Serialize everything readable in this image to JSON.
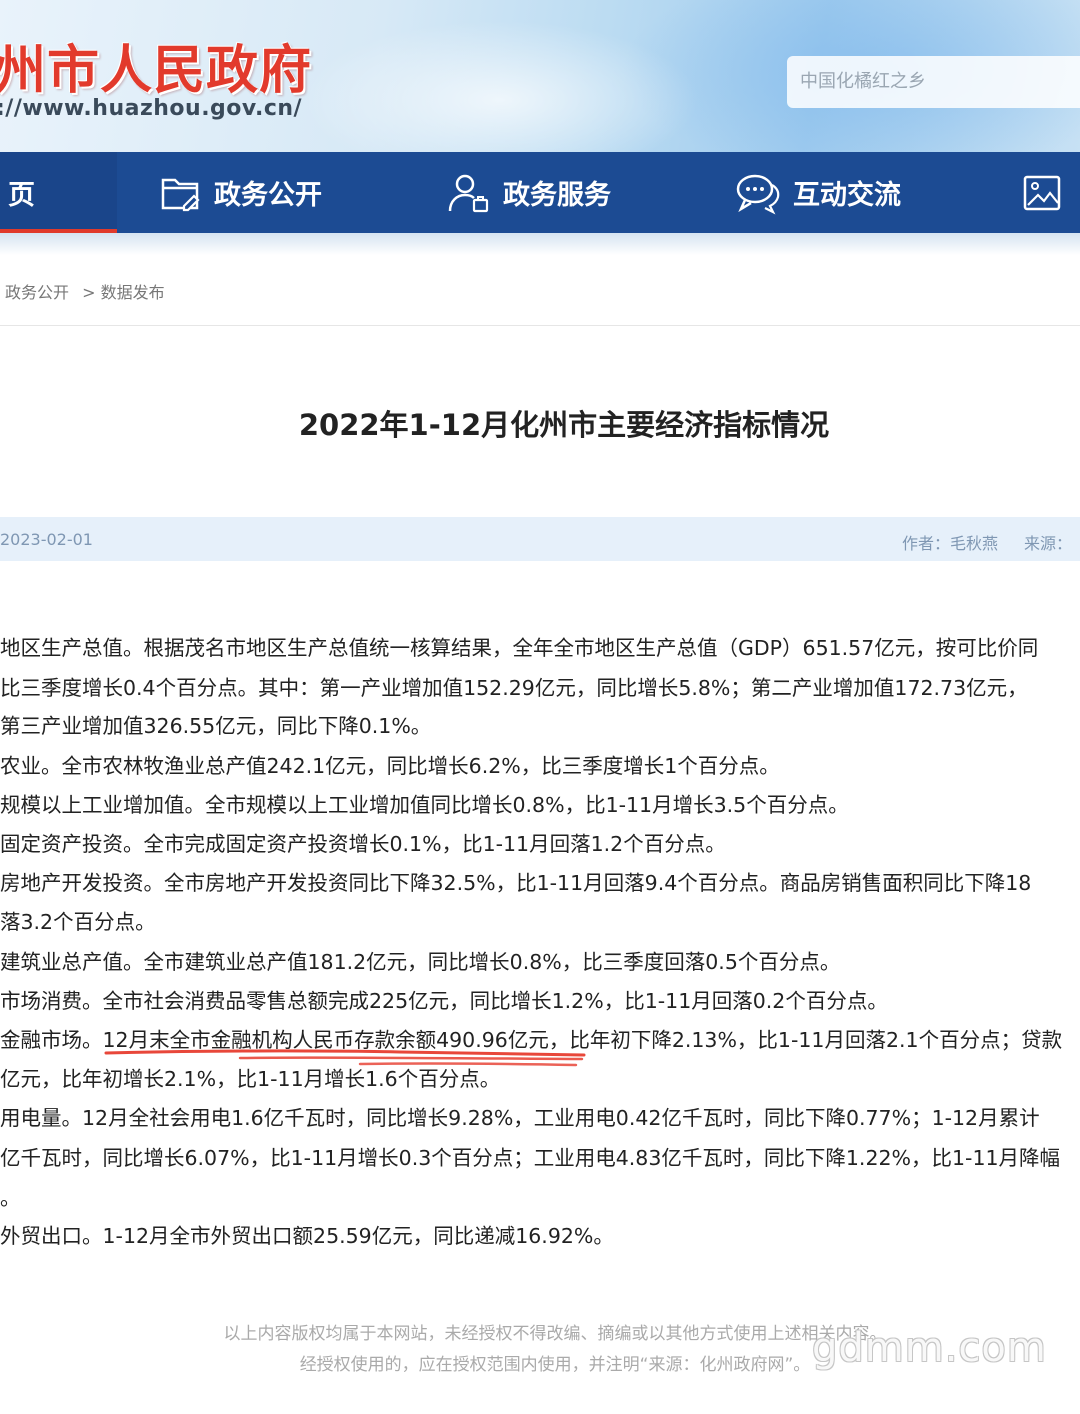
{
  "header": {
    "site_title": "州市人民政府",
    "site_url": "://www.huazhou.gov.cn/",
    "search_placeholder": "中国化橘红之乡"
  },
  "nav": {
    "items": [
      {
        "label": "页",
        "icon": "home"
      },
      {
        "label": "政务公开",
        "icon": "folder-icon"
      },
      {
        "label": "政务服务",
        "icon": "user-service-icon"
      },
      {
        "label": "互动交流",
        "icon": "chat-bubble-icon"
      },
      {
        "label": "",
        "icon": "picture-icon"
      }
    ],
    "active_color": "#e03a2b",
    "bar_color": "#1c4b93"
  },
  "breadcrumb": {
    "items": [
      "政务公开",
      "> 数据发布"
    ]
  },
  "article": {
    "title": "2022年1-12月化州市主要经济指标情况",
    "date": "2023-02-01",
    "author": "作者：毛秋燕",
    "source": "来源：",
    "lines": [
      "地区生产总值。根据茂名市地区生产总值统一核算结果，全年全市地区生产总值（GDP）651.57亿元，按可比价同",
      " 比三季度增长0.4个百分点。其中：第一产业增加值152.29亿元，同比增长5.8%；第二产业增加值172.73亿元，",
      " 第三产业增加值326.55亿元，同比下降0.1%。",
      "农业。全市农林牧渔业总产值242.1亿元，同比增长6.2%，比三季度增长1个百分点。",
      "规模以上工业增加值。全市规模以上工业增加值同比增长0.8%，比1-11月增长3.5个百分点。",
      "固定资产投资。全市完成固定资产投资增长0.1%，比1-11月回落1.2个百分点。",
      "房地产开发投资。全市房地产开发投资同比下降32.5%，比1-11月回落9.4个百分点。商品房销售面积同比下降18",
      "落3.2个百分点。",
      "建筑业总产值。全市建筑业总产值181.2亿元，同比增长0.8%，比三季度回落0.5个百分点。",
      "市场消费。全市社会消费品零售总额完成225亿元，同比增长1.2%，比1-11月回落0.2个百分点。",
      "金融市场。12月末全市金融机构人民币存款余额490.96亿元，比年初下降2.13%，比1-11月回落2.1个百分点；贷款",
      "亿元，比年初增长2.1%，比1-11月增长1.6个百分点。",
      "用电量。12月全社会用电1.6亿千瓦时，同比增长9.28%，工业用电0.42亿千瓦时，同比下降0.77%；1-12月累计",
      "亿千瓦时，同比增长6.07%，比1-11月增长0.3个百分点；工业用电4.83亿千瓦时，同比下降1.22%，比1-11月降幅",
      "。",
      "外贸出口。1-12月全市外贸出口额25.59亿元，同比递减16.92%。"
    ]
  },
  "footer": {
    "line1": "以上内容版权均属于本网站，未经授权不得改编、摘编或以其他方式使用上述相关内容。",
    "line2": "经授权使用的，应在授权范围内使用，并注明“来源：化州政府网”。",
    "watermark": "gdmm.com"
  }
}
